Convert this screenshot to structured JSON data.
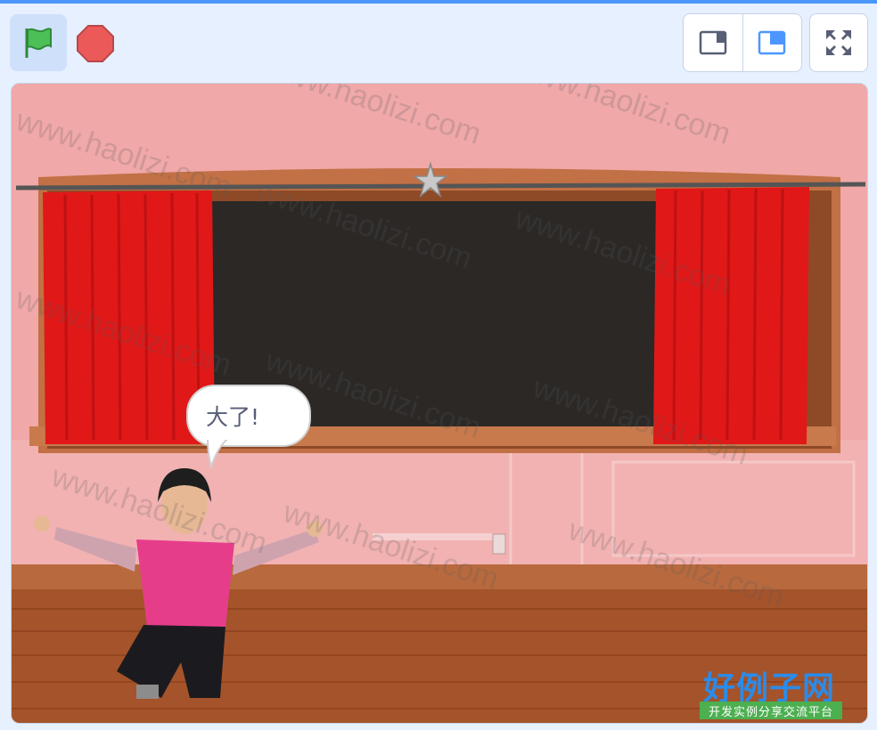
{
  "toolbar": {
    "green_flag": {
      "icon": "green-flag-icon",
      "color": "#4cbf56"
    },
    "stop": {
      "icon": "stop-sign-icon",
      "color": "#ec5959"
    },
    "modes": [
      {
        "name": "small-stage-mode",
        "icon": "small-stage-icon"
      },
      {
        "name": "normal-stage-mode",
        "icon": "normal-stage-icon",
        "active": true
      }
    ],
    "fullscreen": {
      "icon": "fullscreen-icon"
    }
  },
  "stage": {
    "speech_bubble": "大了!",
    "watermark": "www.haolizi.com",
    "logo": {
      "main": "好例子网",
      "sub": "开发实例分享交流平台"
    }
  },
  "colors": {
    "accent": "#4c97ff",
    "wall": "#f0a5a5",
    "curtain": "#e01818",
    "floor": "#a0522d"
  }
}
